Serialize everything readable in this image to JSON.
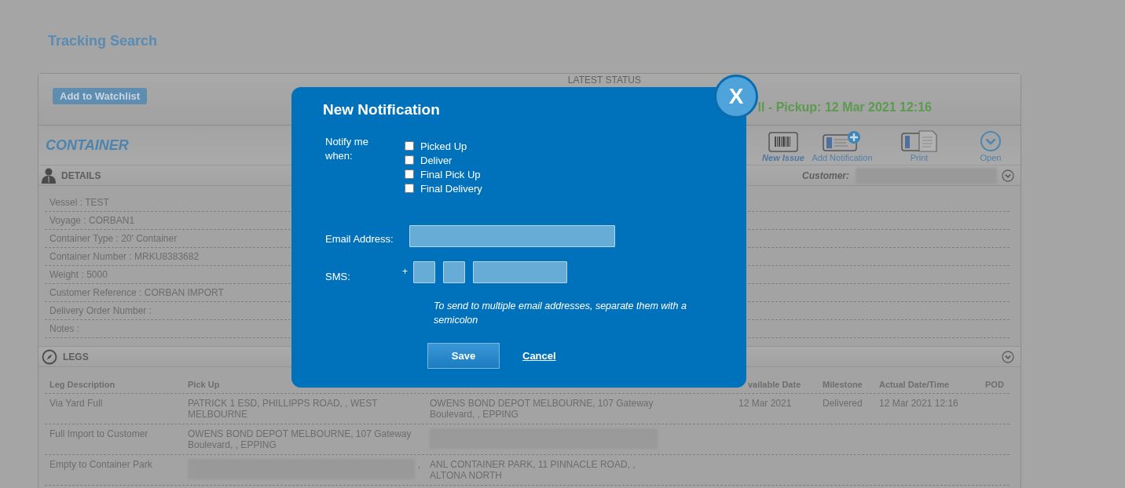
{
  "page_title": "Tracking Search",
  "header": {
    "watchlist_button": "Add to Watchlist",
    "status_label": "LATEST STATUS",
    "status_text": "ll - Pickup: 12 Mar 2021 12:16"
  },
  "container_title": "CONTAINER",
  "toolbar": [
    {
      "kind": "barcode",
      "label": "New Issue",
      "highlighted": true
    },
    {
      "kind": "add-card",
      "label": "Add Notification",
      "highlighted": false
    },
    {
      "kind": "print",
      "label": "Print",
      "highlighted": false
    },
    {
      "kind": "open",
      "label": "Open",
      "highlighted": false
    }
  ],
  "details": {
    "title": "DETAILS",
    "customer_label": "Customer:",
    "customer_value": {
      "kind": "redacted"
    },
    "items": [
      "Vessel : TEST",
      "Voyage : CORBAN1",
      "Container Type : 20' Container",
      "Container Number : MRKU8383682",
      "Weight : 5000",
      "Customer Reference : CORBAN IMPORT",
      "Delivery Order Number :",
      "Notes :"
    ]
  },
  "legs": {
    "title": "LEGS",
    "columns": [
      {
        "kind": "text",
        "label": "Leg Description"
      },
      {
        "kind": "text",
        "label": "Pick Up"
      },
      {
        "kind": "covered"
      },
      {
        "kind": "text",
        "label": "vailable Date"
      },
      {
        "kind": "text",
        "label": "Milestone"
      },
      {
        "kind": "text",
        "label": "Actual Date/Time"
      },
      {
        "kind": "text",
        "label": "POD"
      }
    ],
    "rows": [
      {
        "cells": [
          {
            "kind": "text",
            "text": "Via Yard Full"
          },
          {
            "kind": "text",
            "text": "PATRICK 1 ESD, PHILLIPPS ROAD, , WEST MELBOURNE"
          },
          {
            "kind": "text",
            "text": "OWENS BOND DEPOT MELBOURNE, 107 Gateway Boulevard, , EPPING"
          },
          {
            "kind": "text",
            "text": "12 Mar 2021"
          },
          {
            "kind": "text",
            "text": "Delivered"
          },
          {
            "kind": "text",
            "text": "12 Mar 2021 12:16"
          },
          {
            "kind": "empty"
          }
        ]
      },
      {
        "cells": [
          {
            "kind": "text",
            "text": "Full Import to Customer"
          },
          {
            "kind": "text",
            "text": "OWENS BOND DEPOT MELBOURNE, 107 Gateway Boulevard, , EPPING"
          },
          {
            "kind": "redacted"
          },
          {
            "kind": "empty"
          },
          {
            "kind": "empty"
          },
          {
            "kind": "empty"
          },
          {
            "kind": "empty"
          }
        ]
      },
      {
        "cells": [
          {
            "kind": "text",
            "text": "Empty to Container Park"
          },
          {
            "kind": "redacted",
            "text": ","
          },
          {
            "kind": "text",
            "text": "ANL CONTAINER PARK, 11 PINNACLE ROAD, , ALTONA NORTH"
          },
          {
            "kind": "empty"
          },
          {
            "kind": "empty"
          },
          {
            "kind": "empty"
          },
          {
            "kind": "empty"
          }
        ]
      }
    ]
  },
  "dialog": {
    "title": "New Notification",
    "close_button": "X",
    "notify_label": "Notify me when:",
    "options": [
      {
        "label": "Picked Up",
        "checked": false
      },
      {
        "label": "Deliver",
        "checked": false
      },
      {
        "label": "Final Pick Up",
        "checked": false
      },
      {
        "label": "Final Delivery",
        "checked": false
      }
    ],
    "email_label": "Email Address:",
    "sms_label": "SMS:",
    "sms_prefix": "+",
    "hint": "To send to multiple email addresses, separate them with a semicolon",
    "save_button": "Save",
    "cancel_link": "Cancel"
  }
}
